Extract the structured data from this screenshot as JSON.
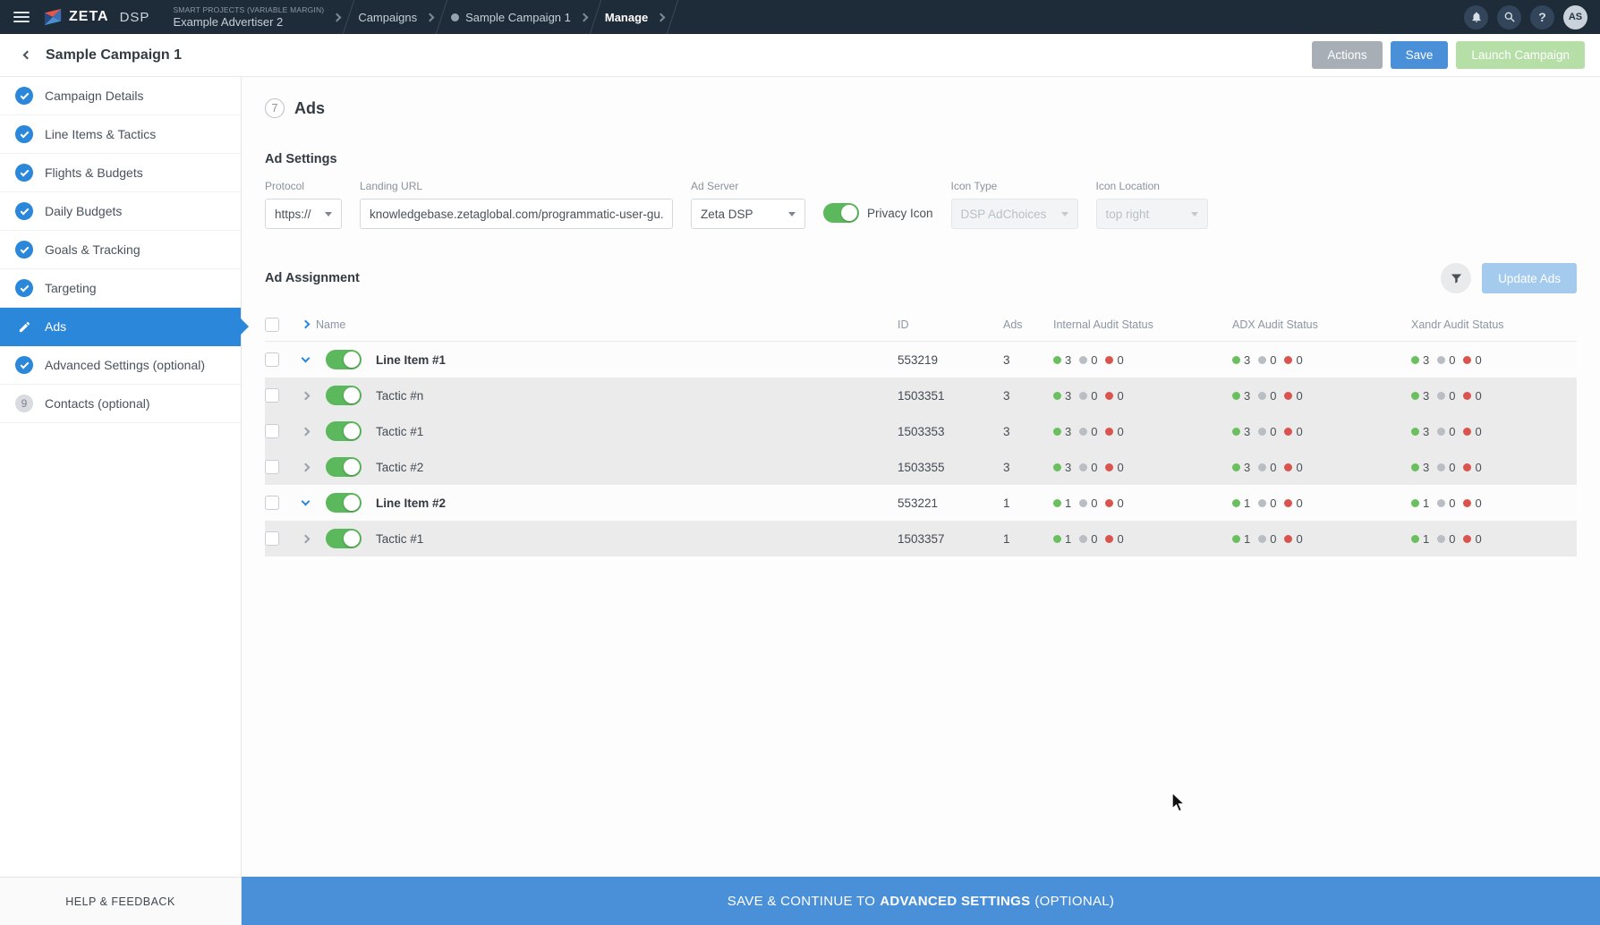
{
  "colors": {
    "topnav_bg": "#1e2b39",
    "accent_blue": "#2b87d9",
    "footer_blue": "#4a90d9",
    "toggle_green": "#5cb85c",
    "status_green": "#6abf5e",
    "status_gray": "#b9bec4",
    "status_red": "#d9534f",
    "launch_green": "#b5dfa6"
  },
  "topnav": {
    "logo_text": "ZETA",
    "logo_suffix": "DSP",
    "breadcrumbs": [
      {
        "eyebrow": "SMART PROJECTS (VARIABLE MARGIN)",
        "label": "Example Advertiser 2"
      },
      {
        "label": "Campaigns"
      },
      {
        "label": "Sample Campaign 1",
        "dot": true
      },
      {
        "label": "Manage",
        "bold": true
      }
    ],
    "help_glyph": "?",
    "avatar": "AS"
  },
  "header": {
    "title": "Sample Campaign 1",
    "actions_label": "Actions",
    "save_label": "Save",
    "launch_label": "Launch Campaign"
  },
  "sidebar": {
    "items": [
      {
        "label": "Campaign Details",
        "state": "done"
      },
      {
        "label": "Line Items & Tactics",
        "state": "done"
      },
      {
        "label": "Flights & Budgets",
        "state": "done"
      },
      {
        "label": "Daily Budgets",
        "state": "done"
      },
      {
        "label": "Goals & Tracking",
        "state": "done"
      },
      {
        "label": "Targeting",
        "state": "done"
      },
      {
        "label": "Ads",
        "state": "active"
      },
      {
        "label": "Advanced Settings (optional)",
        "state": "done"
      },
      {
        "label": "Contacts (optional)",
        "state": "number",
        "number": "9"
      }
    ],
    "help_label": "HELP & FEEDBACK"
  },
  "main": {
    "step_number": "7",
    "title": "Ads",
    "ad_settings": {
      "section_title": "Ad Settings",
      "protocol_label": "Protocol",
      "protocol_value": "https://",
      "landing_url_label": "Landing URL",
      "landing_url_value": "knowledgebase.zetaglobal.com/programmatic-user-gu...",
      "ad_server_label": "Ad Server",
      "ad_server_value": "Zeta DSP",
      "privacy_icon_label": "Privacy Icon",
      "icon_type_label": "Icon Type",
      "icon_type_value": "DSP AdChoices",
      "icon_location_label": "Icon Location",
      "icon_location_value": "top right"
    },
    "ad_assignment": {
      "section_title": "Ad Assignment",
      "update_button": "Update Ads",
      "columns": [
        "Name",
        "ID",
        "Ads",
        "Internal Audit Status",
        "ADX Audit Status",
        "Xandr Audit Status"
      ],
      "rows": [
        {
          "type": "line-item",
          "name": "Line Item #1",
          "id": "553219",
          "ads": "3",
          "internal": [
            3,
            0,
            0
          ],
          "adx": [
            3,
            0,
            0
          ],
          "xandr": [
            3,
            0,
            0
          ]
        },
        {
          "type": "tactic",
          "name": "Tactic #n",
          "id": "1503351",
          "ads": "3",
          "internal": [
            3,
            0,
            0
          ],
          "adx": [
            3,
            0,
            0
          ],
          "xandr": [
            3,
            0,
            0
          ]
        },
        {
          "type": "tactic",
          "name": "Tactic #1",
          "id": "1503353",
          "ads": "3",
          "internal": [
            3,
            0,
            0
          ],
          "adx": [
            3,
            0,
            0
          ],
          "xandr": [
            3,
            0,
            0
          ]
        },
        {
          "type": "tactic",
          "name": "Tactic #2",
          "id": "1503355",
          "ads": "3",
          "internal": [
            3,
            0,
            0
          ],
          "adx": [
            3,
            0,
            0
          ],
          "xandr": [
            3,
            0,
            0
          ]
        },
        {
          "type": "line-item",
          "name": "Line Item #2",
          "id": "553221",
          "ads": "1",
          "internal": [
            1,
            0,
            0
          ],
          "adx": [
            1,
            0,
            0
          ],
          "xandr": [
            1,
            0,
            0
          ]
        },
        {
          "type": "tactic",
          "name": "Tactic #1",
          "id": "1503357",
          "ads": "1",
          "internal": [
            1,
            0,
            0
          ],
          "adx": [
            1,
            0,
            0
          ],
          "xandr": [
            1,
            0,
            0
          ]
        }
      ]
    }
  },
  "footer": {
    "prefix": "SAVE & CONTINUE TO",
    "bold": "ADVANCED SETTINGS",
    "suffix": "(OPTIONAL)"
  }
}
